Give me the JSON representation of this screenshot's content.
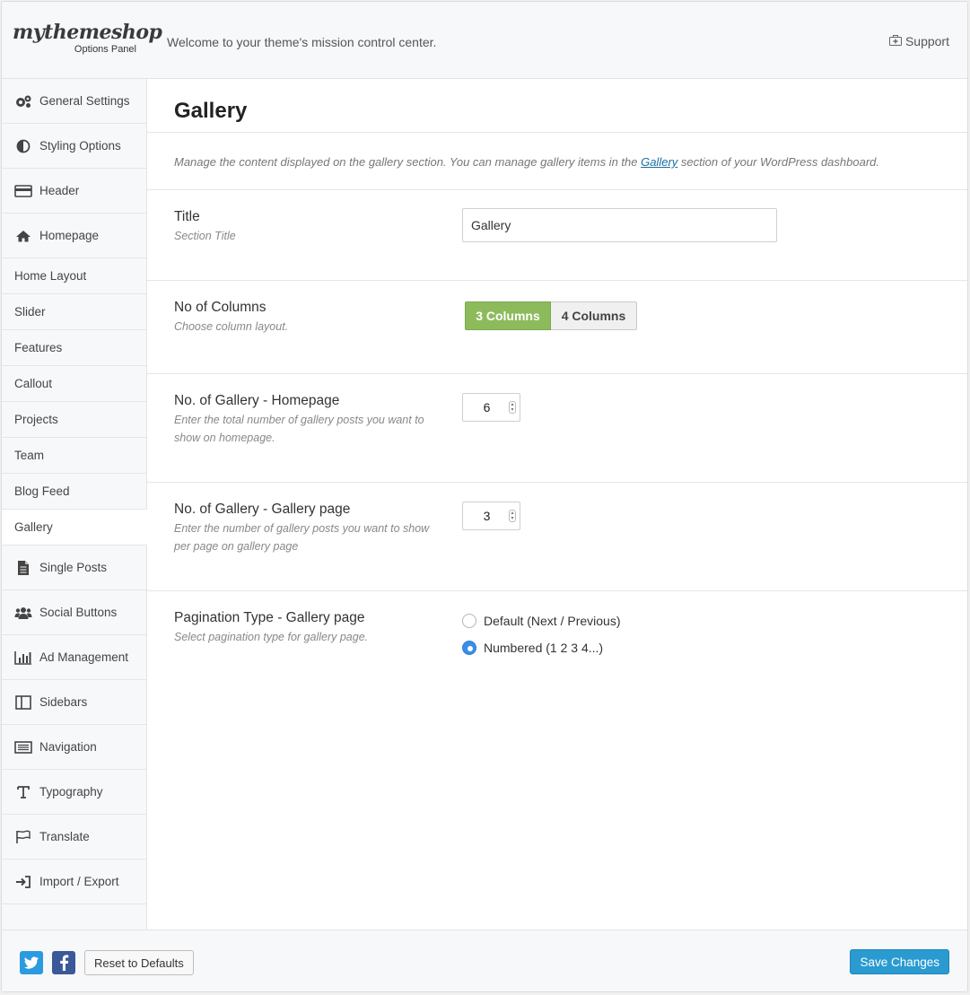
{
  "header": {
    "logo": "mythemeshop",
    "logo_sub": "Options Panel",
    "welcome": "Welcome to your theme's mission control center.",
    "support": "Support"
  },
  "sidebar": {
    "items": [
      {
        "label": "General Settings",
        "icon": "gears-icon"
      },
      {
        "label": "Styling Options",
        "icon": "contrast-icon"
      },
      {
        "label": "Header",
        "icon": "header-card-icon"
      },
      {
        "label": "Homepage",
        "icon": "home-icon"
      },
      {
        "label": "Home Layout"
      },
      {
        "label": "Slider"
      },
      {
        "label": "Features"
      },
      {
        "label": "Callout"
      },
      {
        "label": "Projects"
      },
      {
        "label": "Team"
      },
      {
        "label": "Blog Feed"
      },
      {
        "label": "Gallery",
        "active": true
      },
      {
        "label": "Single Posts",
        "icon": "document-icon"
      },
      {
        "label": "Social Buttons",
        "icon": "users-icon"
      },
      {
        "label": "Ad Management",
        "icon": "bar-chart-icon"
      },
      {
        "label": "Sidebars",
        "icon": "columns-icon"
      },
      {
        "label": "Navigation",
        "icon": "list-icon"
      },
      {
        "label": "Typography",
        "icon": "text-icon"
      },
      {
        "label": "Translate",
        "icon": "flag-icon"
      },
      {
        "label": "Import / Export",
        "icon": "sign-in-icon"
      }
    ]
  },
  "main": {
    "title": "Gallery",
    "desc_before": "Manage the content displayed on the gallery section. You can manage gallery items in the ",
    "desc_link": "Gallery",
    "desc_after": " section of your WordPress dashboard.",
    "title_option": {
      "label": "Title",
      "help": "Section Title",
      "value": "Gallery"
    },
    "columns_option": {
      "label": "No of Columns",
      "help": "Choose column layout.",
      "options": [
        "3 Columns",
        "4 Columns"
      ],
      "selected": "3 Columns"
    },
    "homepage_count": {
      "label": "No. of Gallery - Homepage",
      "help": "Enter the total number of gallery posts you want to show on homepage.",
      "value": "6"
    },
    "page_count": {
      "label": "No. of Gallery - Gallery page",
      "help": "Enter the number of gallery posts you want to show per page on gallery page",
      "value": "3"
    },
    "pagination": {
      "label": "Pagination Type - Gallery page",
      "help": "Select pagination type for gallery page.",
      "options": [
        "Default (Next / Previous)",
        "Numbered (1 2 3 4...)"
      ],
      "selected": "Numbered (1 2 3 4...)"
    }
  },
  "footer": {
    "reset": "Reset to Defaults",
    "save": "Save Changes"
  },
  "colors": {
    "accent": "#8dbb5c",
    "save": "#2a9bd0",
    "radio": "#3a8ee6"
  }
}
